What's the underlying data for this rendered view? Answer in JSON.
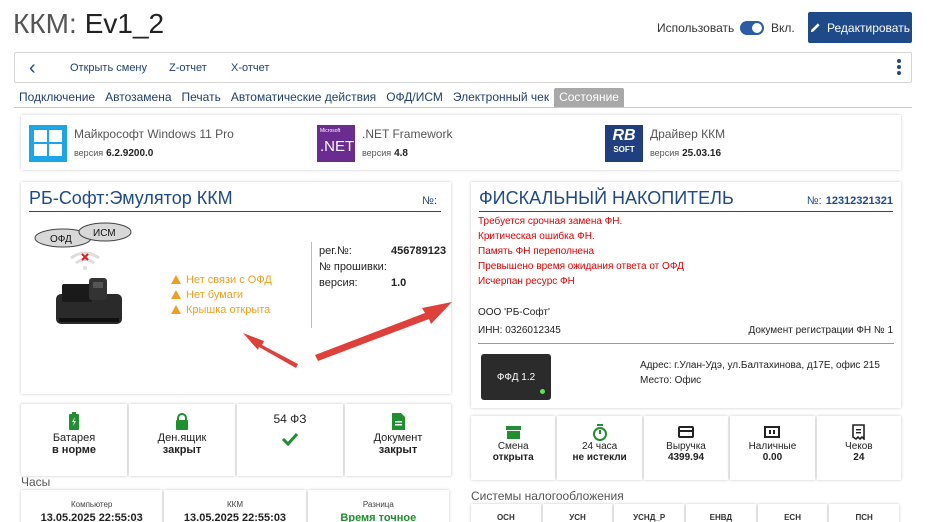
{
  "header": {
    "title_prefix": "ККМ:",
    "title_value": "Ev1_2",
    "use_label": "Использовать",
    "toggle_label": "Вкл.",
    "edit_label": "Редактировать"
  },
  "toolbar": {
    "open_shift": "Открыть смену",
    "z_report": "Z-отчет",
    "x_report": "X-отчет"
  },
  "tabs": [
    "Подключение",
    "Автозамена",
    "Печать",
    "Автоматические действия",
    "ОФД/ИСМ",
    "Электронный чек",
    "Состояние"
  ],
  "software": [
    {
      "name": "Майкрософт Windows 11 Pro",
      "ver_label": "версия",
      "version": "6.2.9200.0",
      "logo_text": ""
    },
    {
      "name": ".NET Framework",
      "ver_label": "версия",
      "version": "4.8",
      "logo_text": ".NET",
      "logo_small": "Microsoft"
    },
    {
      "name": "Драйвер ККМ",
      "ver_label": "версия",
      "version": "25.03.16",
      "logo_text": "RB",
      "logo_small": "SOFT"
    }
  ],
  "kkm": {
    "title": "РБ-Софт:Эмулятор ККМ",
    "number_label": "№:",
    "cloud_ofd": "ОФД",
    "cloud_ism": "ИСМ",
    "warnings": [
      "Нет связи с ОФД",
      "Нет бумаги",
      "Крышка открыта"
    ],
    "info": [
      {
        "label": "рег.№:",
        "value": "456789123"
      },
      {
        "label": "№ прошивки:",
        "value": ""
      },
      {
        "label": "версия:",
        "value": "1.0"
      }
    ]
  },
  "fn": {
    "title": "ФИСКАЛЬНЫЙ НАКОПИТЕЛЬ",
    "number_label": "№:",
    "number": "12312321321",
    "errors": [
      "Требуется срочная замена ФН.",
      "Критическая ошибка ФН.",
      "Память ФН переполнена",
      "Превышено время ожидания ответа от ОФД",
      "Исчерпан ресурс ФН"
    ],
    "org": "ООО 'РБ-Софт'",
    "inn": "ИНН:  0326012345",
    "doc": "Документ регистрации ФН № 1",
    "chip_label": "ФФД 1.2",
    "address": "Адрес: г.Улан-Удэ, ул.Балтахинова, д17Е, офис 215",
    "place": "Место:  Офис"
  },
  "status_left": [
    {
      "icon": "battery-icon",
      "l1": "Батарея",
      "l2": "в норме"
    },
    {
      "icon": "lock-icon",
      "l1": "Ден.ящик",
      "l2": "закрыт"
    },
    {
      "icon": "check-icon",
      "l1": "54 ФЗ",
      "l2": ""
    },
    {
      "icon": "document-icon",
      "l1": "Документ",
      "l2": "закрыт"
    }
  ],
  "status_right": [
    {
      "icon": "shift-icon",
      "l1": "Смена",
      "l2": "открыта"
    },
    {
      "icon": "timer-icon",
      "l1": "24 часа",
      "l2": "не истекли"
    },
    {
      "icon": "card-icon",
      "l1": "Выручка",
      "l2": "4399.94"
    },
    {
      "icon": "cash-icon",
      "l1": "Наличные",
      "l2": "0.00"
    },
    {
      "icon": "receipt-icon",
      "l1": "Чеков",
      "l2": "24"
    }
  ],
  "clocks": {
    "title": "Часы",
    "items": [
      {
        "label": "Компьютер",
        "value": "13.05.2025 22:55:03"
      },
      {
        "label": "ККМ",
        "value": "13.05.2025 22:55:03"
      },
      {
        "label": "Разница",
        "value": "Время точное"
      }
    ]
  },
  "tax": {
    "title": "Системы налогообложения",
    "items": [
      "ОСН",
      "УСН",
      "УСНД_Р",
      "ЕНВД",
      "ЕСН",
      "ПСН"
    ]
  },
  "colors": {
    "accent": "#1f4a8a",
    "warning": "#f0a020",
    "error": "#e00000",
    "ok": "#1f8f2f",
    "annotation_arrow": "#e0403a"
  }
}
